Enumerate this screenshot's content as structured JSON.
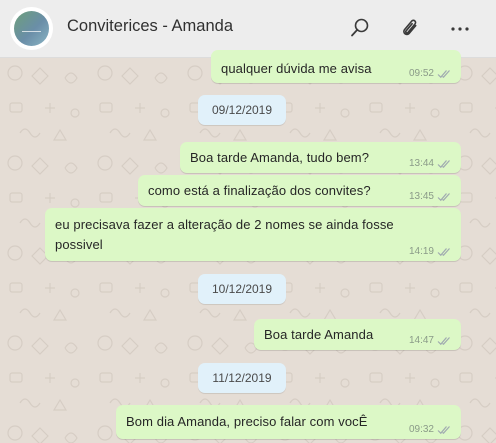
{
  "header": {
    "contact_name": "Conviterices - Amanda",
    "icons": [
      "search-icon",
      "paperclip-icon",
      "more-options-icon"
    ]
  },
  "colors": {
    "outgoing_bubble": "#dcf8c6",
    "date_pill": "#e1f1fa",
    "chat_background": "#e5ddd5",
    "header_background": "#ededed",
    "read_ticks": "#a0aab0"
  },
  "messages": [
    {
      "text": "qualquer dúvida me avisa",
      "time": "09:52",
      "status": "read"
    },
    {
      "text": "Boa tarde Amanda, tudo bem?",
      "time": "13:44",
      "status": "read"
    },
    {
      "text": "como está a finalização dos convites?",
      "time": "13:45",
      "status": "read"
    },
    {
      "text": "eu precisava fazer a alteração de 2 nomes se ainda fosse\npossivel",
      "time": "14:19",
      "status": "read"
    },
    {
      "text": "Boa tarde Amanda",
      "time": "14:47",
      "status": "read"
    },
    {
      "text": "Bom dia Amanda, preciso falar com vocÊ",
      "time": "09:32",
      "status": "read"
    }
  ],
  "dates": [
    "09/12/2019",
    "10/12/2019",
    "11/12/2019"
  ]
}
